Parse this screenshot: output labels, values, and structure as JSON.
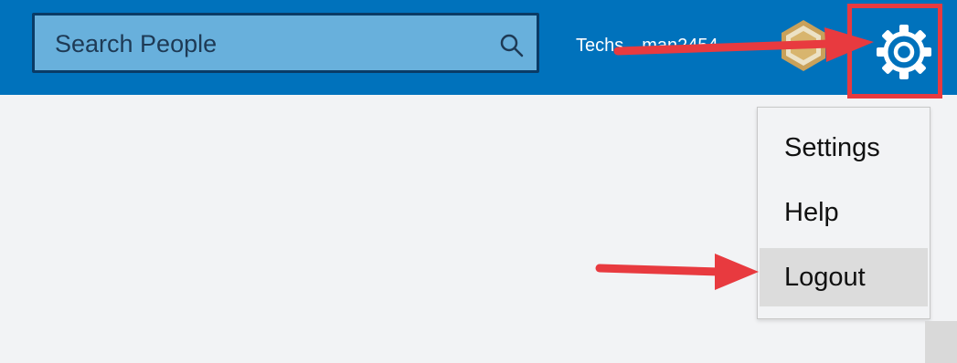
{
  "header": {
    "search": {
      "placeholder": "Search People",
      "value": ""
    },
    "username": "Techs…man2454",
    "icons": {
      "search": "search-icon",
      "badge": "badge-icon",
      "settings": "gear-icon"
    }
  },
  "menu": {
    "items": [
      {
        "label": "Settings",
        "active": false
      },
      {
        "label": "Help",
        "active": false
      },
      {
        "label": "Logout",
        "active": true
      }
    ]
  },
  "annotations": {
    "arrow_color": "#e83a3f",
    "highlight_color": "#e83a3f"
  },
  "colors": {
    "header": "#0072bc",
    "search_bg": "#68b0dc",
    "page_bg": "#f2f3f5",
    "menu_hover": "#dcdcdc"
  }
}
